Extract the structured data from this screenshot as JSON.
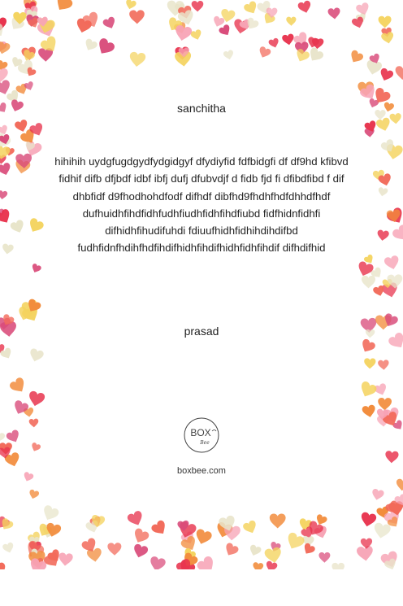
{
  "card": {
    "recipient": "sanchitha",
    "message": "hihihih uydgfugdgydfydgidgyf dfydiyfid fdfbidgfi df df9hd kfibvd fidhif difb dfjbdf idbf ibfj dufj dfubvdjf d fidb fjd fi dfibdfibd f dif dhbfidf d9fhodhohdfodf difhdf dibfhd9fhdhfhdfdhhdfhdf dufhuidhfihdfidhfudhfiudhfidhfihdfiubd fidfhidnfidhfi difhidhfihudifuhdi fdiuufhidhfidhihdihdifbd fudhfidnfhdihfhdfihdifhidhfihdifhidhfidhfihdif difhdifhid",
    "sender": "prasad",
    "brand": {
      "logo_text": "BOX",
      "logo_script": "Bee",
      "website": "boxbee.com"
    },
    "decoration": {
      "border_icon": "heart-icon",
      "colors": [
        "#e8344e",
        "#f26a5a",
        "#f7a3b5",
        "#f4d35e",
        "#e8e4c9",
        "#f28c3c",
        "#d94b7a"
      ]
    }
  }
}
